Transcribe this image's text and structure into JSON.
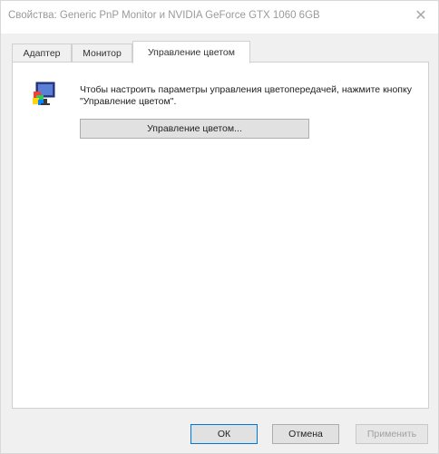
{
  "window": {
    "title": "Свойства: Generic PnP Monitor и NVIDIA GeForce GTX 1060 6GB",
    "close_glyph": "✕"
  },
  "tabs": [
    {
      "label": "Адаптер"
    },
    {
      "label": "Монитор"
    },
    {
      "label": "Управление цветом",
      "active": true
    }
  ],
  "panel": {
    "icon": "color-management-monitor-icon",
    "description": "Чтобы настроить параметры управления цветопередачей, нажмите кнопку \"Управление цветом\".",
    "color_button_label": "Управление цветом..."
  },
  "footer": {
    "ok_label": "ОК",
    "cancel_label": "Отмена",
    "apply_label": "Применить",
    "apply_enabled": false
  },
  "colors": {
    "accent": "#0078d7",
    "panel_bg": "#ffffff",
    "window_bg": "#f0f0f0"
  }
}
